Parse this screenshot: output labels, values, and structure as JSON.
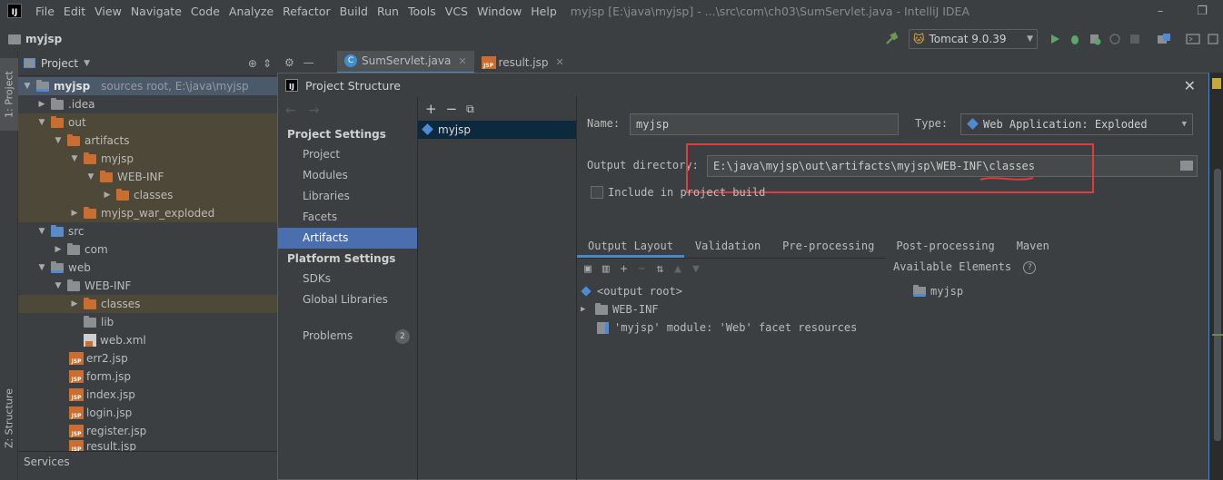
{
  "menubar": {
    "logo": "IJ",
    "items": [
      "File",
      "Edit",
      "View",
      "Navigate",
      "Code",
      "Analyze",
      "Refactor",
      "Build",
      "Run",
      "Tools",
      "VCS",
      "Window",
      "Help"
    ],
    "window_title": "myjsp [E:\\java\\myjsp] - ...\\src\\com\\ch03\\SumServlet.java - IntelliJ IDEA",
    "controls": {
      "minimize": "–",
      "restore": "❐"
    }
  },
  "navbar": {
    "project": "myjsp",
    "run_config": "Tomcat 9.0.39"
  },
  "left_stripe": {
    "project_tab": "1: Project",
    "structure_tab": "Z: Structure"
  },
  "project_panel": {
    "title": "Project",
    "root": {
      "name": "myjsp",
      "sub": "sources root,  E:\\java\\myjsp"
    },
    "tree": [
      {
        "label": "myjsp",
        "sub": "sources root,  E:\\java\\myjsp"
      },
      {
        "label": ".idea"
      },
      {
        "label": "out"
      },
      {
        "label": "artifacts"
      },
      {
        "label": "myjsp"
      },
      {
        "label": "WEB-INF"
      },
      {
        "label": "classes"
      },
      {
        "label": "myjsp_war_exploded"
      },
      {
        "label": "src"
      },
      {
        "label": "com"
      },
      {
        "label": "web"
      },
      {
        "label": "WEB-INF"
      },
      {
        "label": "classes"
      },
      {
        "label": "lib"
      },
      {
        "label": "web.xml"
      },
      {
        "label": "err2.jsp"
      },
      {
        "label": "form.jsp"
      },
      {
        "label": "index.jsp"
      },
      {
        "label": "login.jsp"
      },
      {
        "label": "register.jsp"
      },
      {
        "label": "result.jsp"
      }
    ],
    "services_label": "Services",
    "jsp_badge": "JSP"
  },
  "editor_tabs": [
    {
      "label": "SumServlet.java",
      "icon": "c-class-icon"
    },
    {
      "label": "result.jsp",
      "icon": "jsp-file-icon"
    }
  ],
  "dialog": {
    "title": "Project Structure",
    "nav": {
      "project_settings": "Project Settings",
      "project_items": [
        "Project",
        "Modules",
        "Libraries",
        "Facets",
        "Artifacts"
      ],
      "platform_settings": "Platform Settings",
      "platform_items": [
        "SDKs",
        "Global Libraries"
      ],
      "problems": "Problems",
      "problems_count": "2"
    },
    "artifact_list": [
      "myjsp"
    ],
    "detail": {
      "name_label": "Name:",
      "name_value": "myjsp",
      "type_label": "Type:",
      "type_value": "Web Application: Exploded",
      "output_dir_label": "Output directory:",
      "output_dir_value": "E:\\java\\myjsp\\out\\artifacts\\myjsp\\WEB-INF\\classes",
      "include_in_build": "Include in project build",
      "subtabs": [
        "Output Layout",
        "Validation",
        "Pre-processing",
        "Post-processing",
        "Maven"
      ],
      "available_elements": "Available Elements",
      "layout_rows": [
        "<output root>",
        "WEB-INF",
        "'myjsp' module: 'Web' facet resources"
      ],
      "available_items": [
        "myjsp"
      ]
    }
  },
  "colors": {
    "highlight": "#e03c3c",
    "selection": "#4b6eaf",
    "accent": "#4a88c7"
  }
}
